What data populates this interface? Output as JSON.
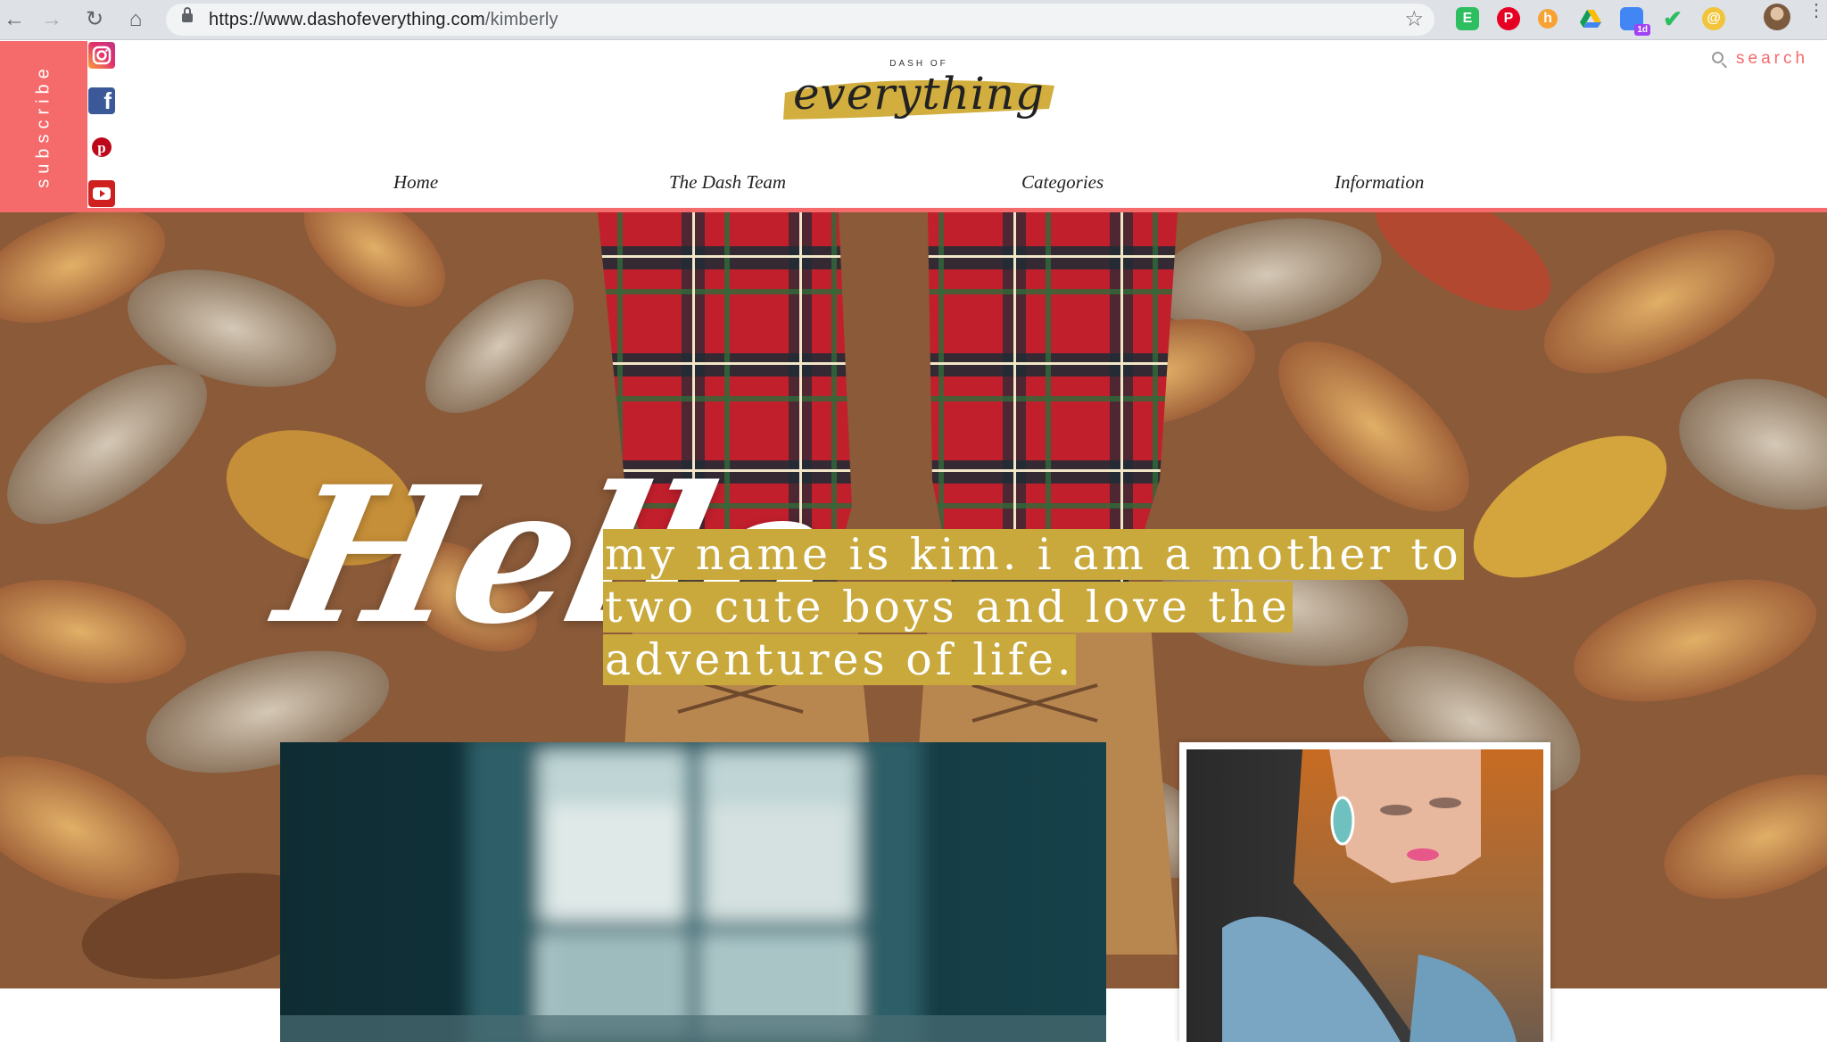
{
  "browser": {
    "url_main": "https://www.dashofeverything.com",
    "url_path": "/kimberly",
    "extensions": [
      "evernote-icon",
      "pinterest-icon",
      "honey-icon",
      "google-drive-icon",
      "calendar-icon",
      "todoist-icon",
      "extension-icon"
    ],
    "calendar_badge": "1d"
  },
  "site": {
    "subscribe_label": "subscribe",
    "social": [
      "instagram-icon",
      "facebook-icon",
      "pinterest-icon",
      "youtube-icon"
    ],
    "logo_small": "DASH OF",
    "logo_script": "everything",
    "search_label": "search",
    "nav": [
      "Home",
      "The Dash Team",
      "Categories",
      "Information"
    ],
    "colors": {
      "accent": "#f56a6a",
      "mustard": "#c9a93c"
    }
  },
  "hero": {
    "heading": "Hello",
    "intro": "my name is kim. i am a mother to two cute boys and love the adventures of life."
  }
}
